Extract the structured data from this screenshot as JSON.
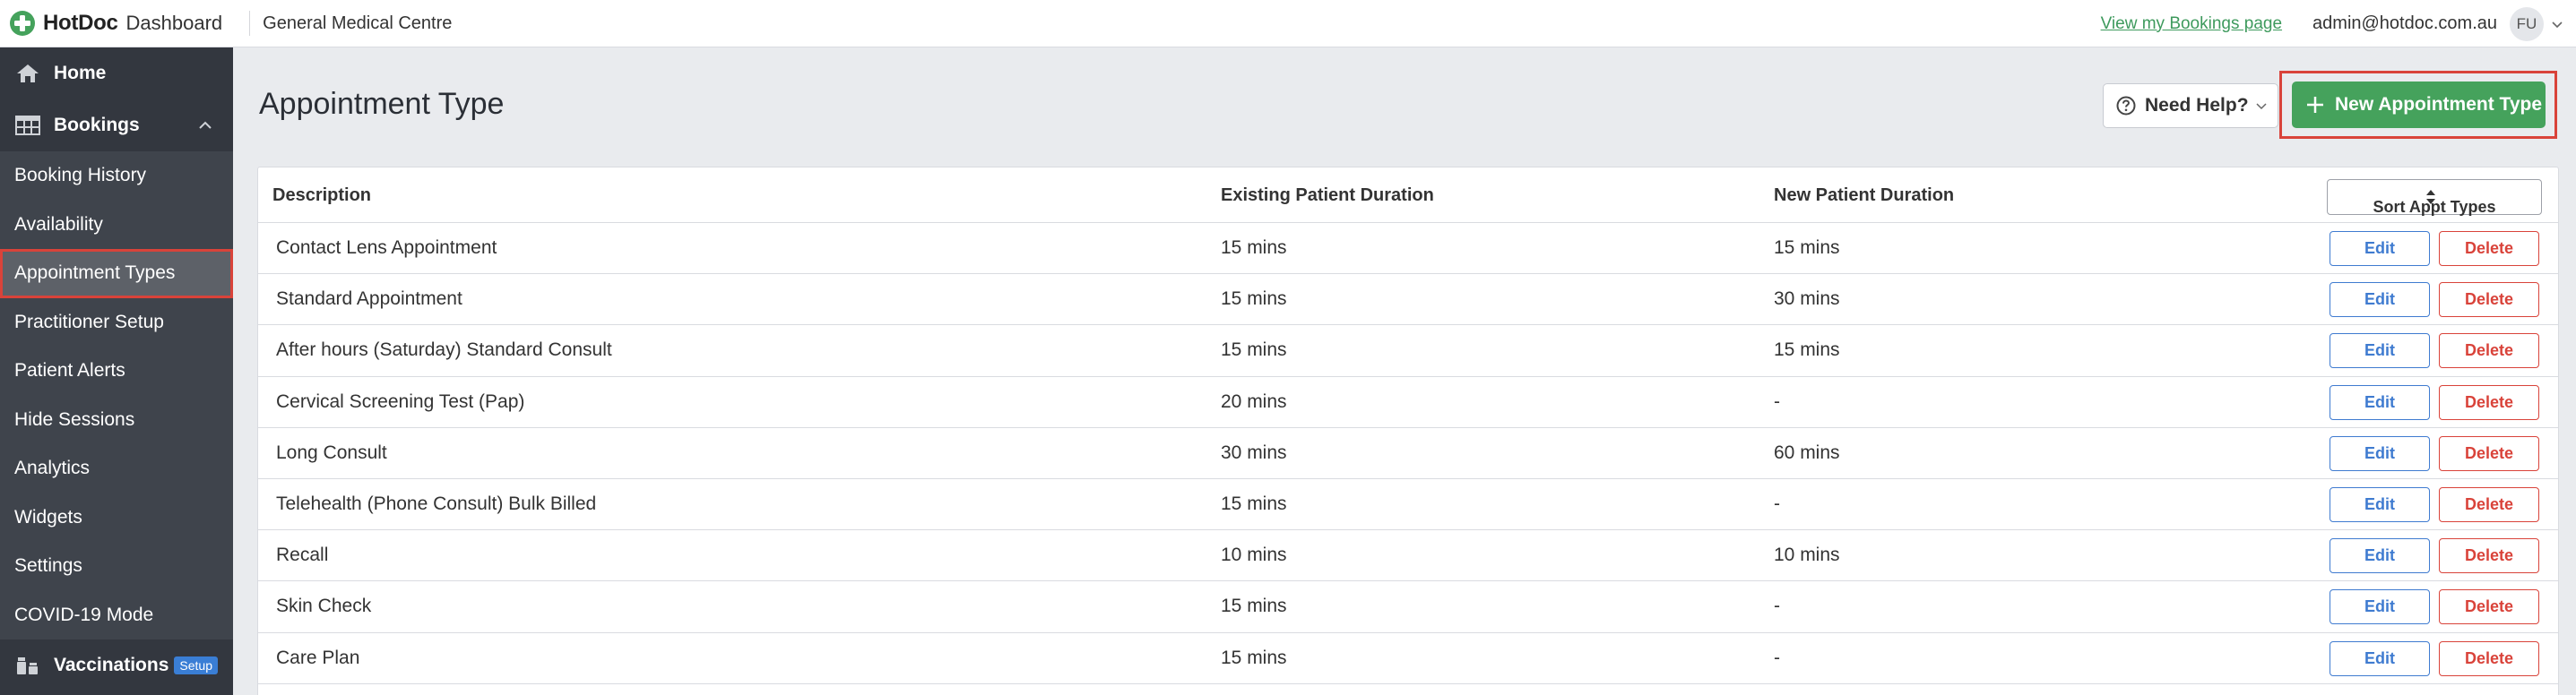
{
  "header": {
    "brand": "HotDoc",
    "product": "Dashboard",
    "practice": "General Medical Centre",
    "bookings_link": "View my Bookings page",
    "user_email": "admin@hotdoc.com.au",
    "avatar_initials": "FU"
  },
  "sidebar": {
    "home_label": "Home",
    "bookings_label": "Bookings",
    "items": [
      {
        "label": "Booking History"
      },
      {
        "label": "Availability"
      },
      {
        "label": "Appointment Types",
        "active": true
      },
      {
        "label": "Practitioner Setup"
      },
      {
        "label": "Patient Alerts"
      },
      {
        "label": "Hide Sessions"
      },
      {
        "label": "Analytics"
      },
      {
        "label": "Widgets"
      },
      {
        "label": "Settings"
      },
      {
        "label": "COVID-19 Mode"
      }
    ],
    "vaccinations_label": "Vaccinations",
    "vaccinations_badge": "Setup"
  },
  "main": {
    "title": "Appointment Type",
    "help_label": "Need Help?",
    "new_button_label": "New Appointment Type",
    "table": {
      "headers": [
        "Description",
        "Existing Patient Duration",
        "New Patient Duration"
      ],
      "sort_label": "Sort Appt Types",
      "edit_label": "Edit",
      "delete_label": "Delete",
      "rows": [
        {
          "description": "Contact Lens Appointment",
          "existing": "15 mins",
          "new": "15 mins"
        },
        {
          "description": "Standard Appointment",
          "existing": "15 mins",
          "new": "30 mins"
        },
        {
          "description": "After hours (Saturday) Standard Consult",
          "existing": "15 mins",
          "new": "15 mins"
        },
        {
          "description": "Cervical Screening Test (Pap)",
          "existing": "20 mins",
          "new": "-"
        },
        {
          "description": "Long Consult",
          "existing": "30 mins",
          "new": "60 mins"
        },
        {
          "description": "Telehealth (Phone Consult) Bulk Billed",
          "existing": "15 mins",
          "new": "-"
        },
        {
          "description": "Recall",
          "existing": "10 mins",
          "new": "10 mins"
        },
        {
          "description": "Skin Check",
          "existing": "15 mins",
          "new": "-"
        },
        {
          "description": "Care Plan",
          "existing": "15 mins",
          "new": "-"
        }
      ]
    }
  },
  "colors": {
    "accent_green": "#45a25c",
    "highlight_red": "#d9433a",
    "edit_blue": "#3f7bd0",
    "sidebar_bg": "#33373f"
  }
}
